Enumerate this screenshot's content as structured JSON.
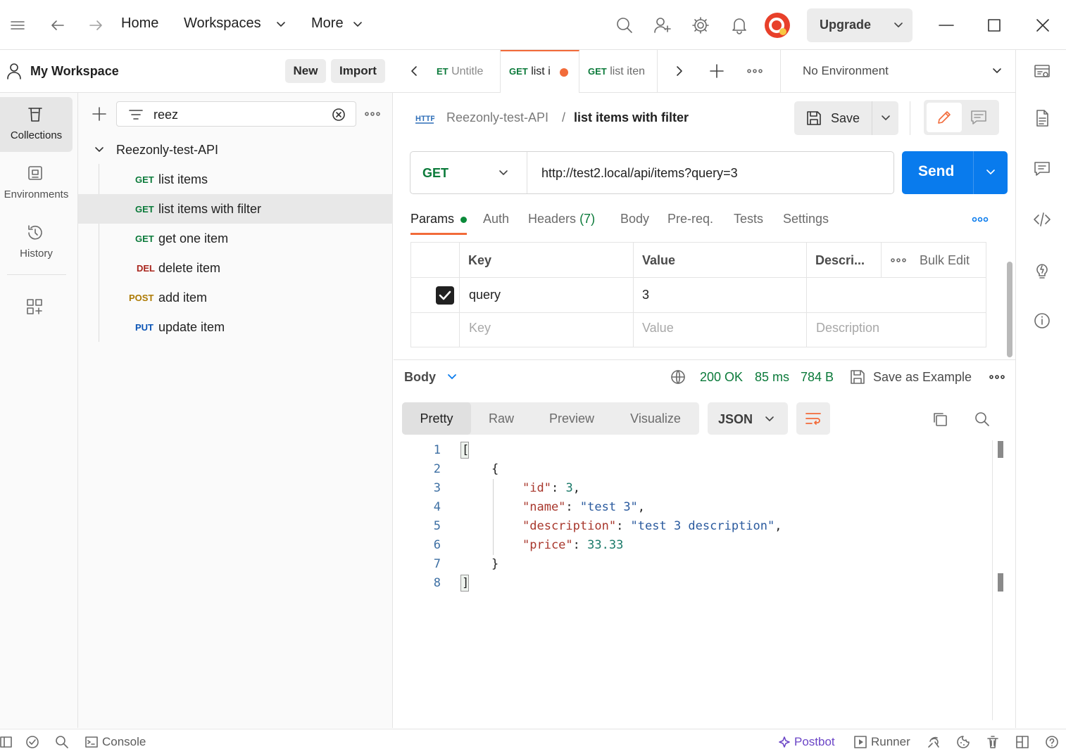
{
  "nav": {
    "home": "Home",
    "workspaces": "Workspaces",
    "more": "More",
    "upgrade": "Upgrade"
  },
  "workspace": {
    "name": "My Workspace",
    "new_label": "New",
    "import_label": "Import"
  },
  "rail": {
    "collections": "Collections",
    "environments": "Environments",
    "history": "History"
  },
  "sidebar": {
    "search_value": "reez",
    "collection_name": "Reezonly-test-API",
    "requests": [
      {
        "method": "GET",
        "name": "list items",
        "color": "#0b7a3a"
      },
      {
        "method": "GET",
        "name": "list items with filter",
        "color": "#0b7a3a"
      },
      {
        "method": "GET",
        "name": "get one item",
        "color": "#0b7a3a"
      },
      {
        "method": "DEL",
        "name": "delete item",
        "color": "#a8251c"
      },
      {
        "method": "POST",
        "name": "add item",
        "color": "#ad7a03"
      },
      {
        "method": "PUT",
        "name": "update item",
        "color": "#0b54b5"
      }
    ]
  },
  "tabs": [
    {
      "method": "ET",
      "name": "Untitle"
    },
    {
      "method": "GET",
      "name": "list i"
    },
    {
      "method": "GET",
      "name": "list iten"
    }
  ],
  "environment": "No Environment",
  "request": {
    "crumb_collection": "Reezonly-test-API",
    "crumb_sep": "/",
    "crumb_name": "list items with filter",
    "save_label": "Save",
    "method": "GET",
    "url": "http://test2.local/api/items?query=3",
    "send_label": "Send",
    "subtabs": {
      "params": "Params",
      "auth": "Auth",
      "headers": "Headers",
      "headers_count": "(7)",
      "body": "Body",
      "prereq": "Pre-req.",
      "tests": "Tests",
      "settings": "Settings"
    },
    "params": {
      "headers": {
        "key": "Key",
        "value": "Value",
        "desc": "Descri...",
        "bulk": "Bulk Edit"
      },
      "row": {
        "key": "query",
        "value": "3"
      },
      "placeholders": {
        "key": "Key",
        "value": "Value",
        "desc": "Description"
      }
    }
  },
  "response": {
    "body_label": "Body",
    "status": "200 OK",
    "time": "85 ms",
    "size": "784 B",
    "save_example": "Save as Example",
    "views": {
      "pretty": "Pretty",
      "raw": "Raw",
      "preview": "Preview",
      "visualize": "Visualize"
    },
    "format": "JSON",
    "line_numbers": [
      "1",
      "2",
      "3",
      "4",
      "5",
      "6",
      "7",
      "8"
    ],
    "json": {
      "open_bracket": "[",
      "open_brace": "{",
      "id_key": "\"id\"",
      "id_val": "3",
      "name_key": "\"name\"",
      "name_val": "\"test 3\"",
      "desc_key": "\"description\"",
      "desc_val": "\"test 3 description\"",
      "price_key": "\"price\"",
      "price_val": "33.33",
      "close_brace": "}",
      "close_bracket": "]"
    }
  },
  "statusbar": {
    "console": "Console",
    "postbot": "Postbot",
    "runner": "Runner"
  },
  "colors": {
    "accent": "#097bed",
    "orange": "#f26b3a",
    "get": "#0b7a3a",
    "ok": "#0b7a3a"
  }
}
